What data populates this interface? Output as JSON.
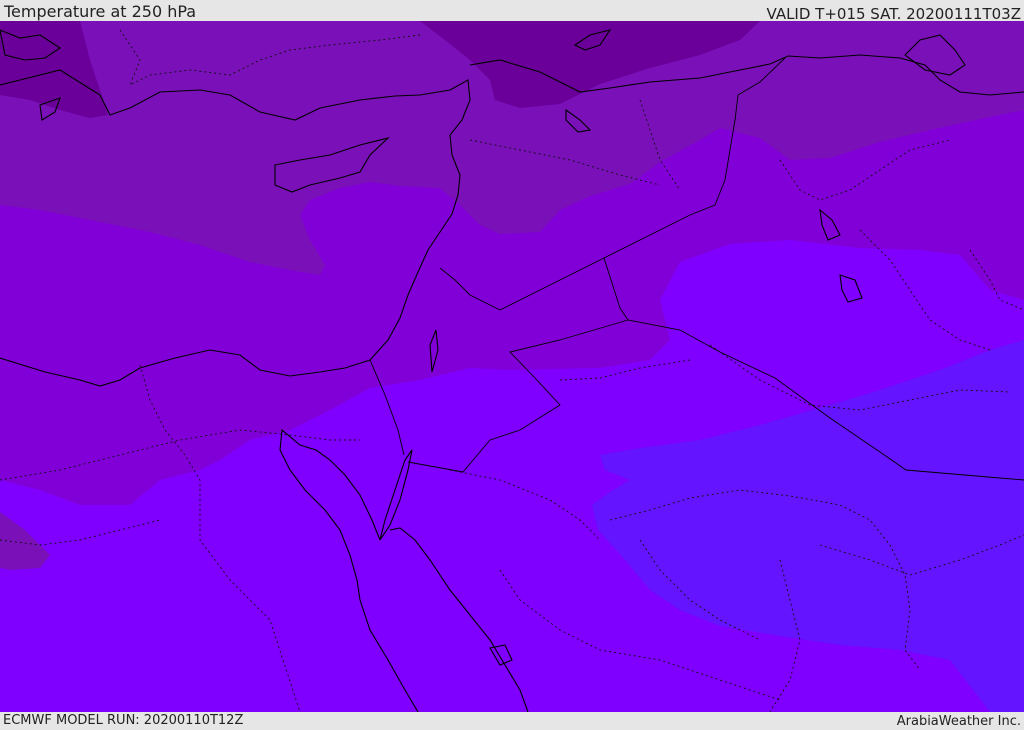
{
  "header": {
    "title": "Temperature at 250 hPa",
    "valid_time": "VALID T+015 SAT. 20200111T03Z"
  },
  "footer": {
    "model_run": "ECMWF MODEL RUN: 20200110T12Z",
    "credit": "ArabiaWeather Inc."
  },
  "colors": {
    "coldest_band": "#6a0099",
    "cold_band": "#7a10b8",
    "mid_band": "#8200d8",
    "base_band": "#7f00ff",
    "warm_band": "#6414ff",
    "coastline": "#000000",
    "frame": "#e6e6e6"
  }
}
